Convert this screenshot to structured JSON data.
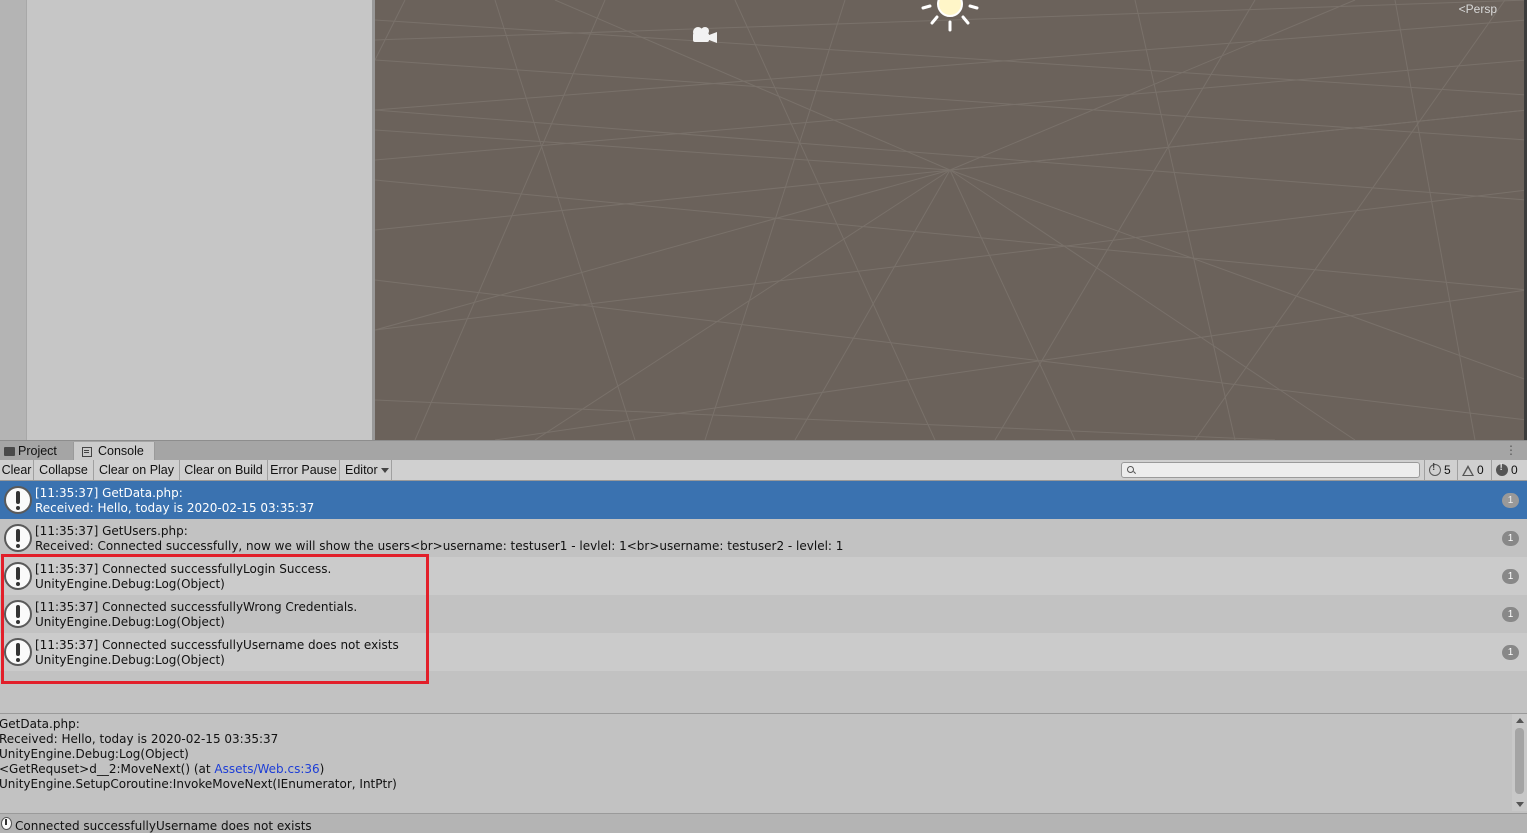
{
  "scene": {
    "view_mode": "Persp",
    "icons": [
      "camera-icon",
      "sun-icon"
    ]
  },
  "tabs": [
    {
      "label": "Project",
      "icon": "folder-icon"
    },
    {
      "label": "Console",
      "icon": "console-icon",
      "active": true
    }
  ],
  "toolbar": {
    "clear": "Clear",
    "collapse": "Collapse",
    "clear_on_play": "Clear on Play",
    "clear_on_build": "Clear on Build",
    "error_pause": "Error Pause",
    "editor": "Editor",
    "search_placeholder": "",
    "counts": {
      "log": "5",
      "warning": "0",
      "error": "0"
    }
  },
  "logs": [
    {
      "line1": "[11:35:37] GetData.php:",
      "line2": "Received: Hello, today is 2020-02-15 03:35:37",
      "count": "1",
      "selected": true
    },
    {
      "line1": "[11:35:37] GetUsers.php:",
      "line2": "Received: Connected successfully, now we will show the users<br>username: testuser1 - levlel: 1<br>username: testuser2 - levlel: 1",
      "count": "1"
    },
    {
      "line1": "[11:35:37] Connected successfullyLogin Success.",
      "line2": "UnityEngine.Debug:Log(Object)",
      "count": "1"
    },
    {
      "line1": "[11:35:37] Connected successfullyWrong Credentials.",
      "line2": "UnityEngine.Debug:Log(Object)",
      "count": "1"
    },
    {
      "line1": "[11:35:37] Connected successfullyUsername does not exists",
      "line2": "UnityEngine.Debug:Log(Object)",
      "count": "1"
    }
  ],
  "details": {
    "line1": "GetData.php:",
    "line2": "Received: Hello, today is 2020-02-15 03:35:37",
    "line3": "UnityEngine.Debug:Log(Object)",
    "line4_prefix": "<GetRequset>d__2:MoveNext() (at ",
    "line4_link": "Assets/Web.cs:36",
    "line4_suffix": ")",
    "line5": "UnityEngine.SetupCoroutine:InvokeMoveNext(IEnumerator, IntPtr)"
  },
  "status_bar": {
    "text": "Connected successfullyUsername does not exists"
  },
  "colors": {
    "selection": "#3a72b0",
    "highlight_box": "#e21f2a",
    "link": "#1c3dd6",
    "scene_bg": "#6b625b"
  }
}
